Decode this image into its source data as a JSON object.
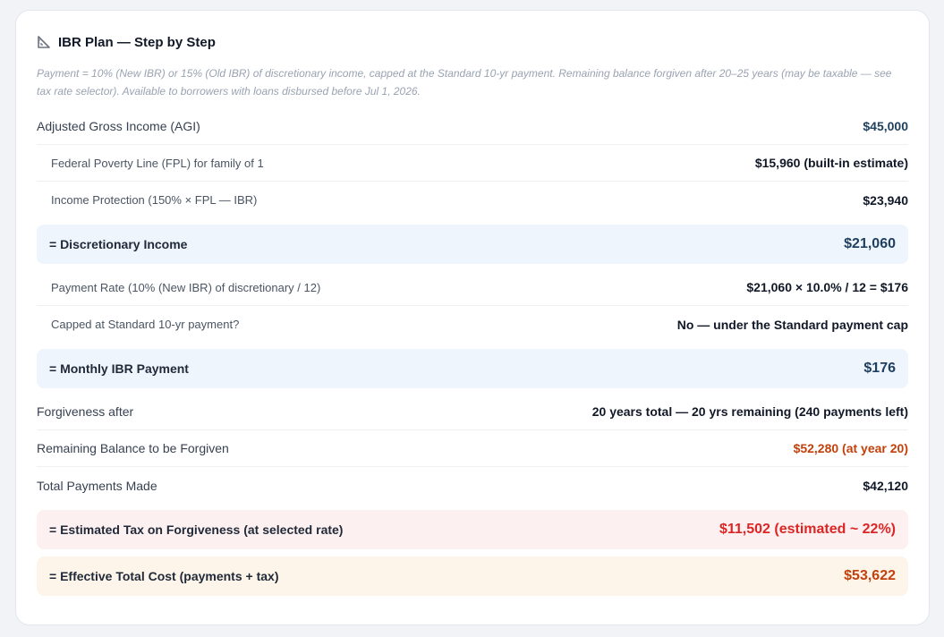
{
  "header": {
    "icon": "ruler-triangle-icon",
    "title": "IBR Plan — Step by Step"
  },
  "note": "Payment = 10% (New IBR) or 15% (Old IBR) of discretionary income, capped at the Standard 10-yr payment. Remaining balance forgiven after 20–25 years (may be taxable — see tax rate selector). Available to borrowers with loans disbursed before Jul 1, 2026.",
  "rows": {
    "agi": {
      "label": "Adjusted Gross Income (AGI)",
      "value": "$45,000"
    },
    "fpl": {
      "label": "Federal Poverty Line (FPL) for family of 1",
      "value": "$15,960 (built-in estimate)"
    },
    "protection": {
      "label": "Income Protection (150% × FPL — IBR)",
      "value": "$23,940"
    },
    "discretionary": {
      "label": "= Discretionary Income",
      "value": "$21,060"
    },
    "rate": {
      "label": "Payment Rate (10% (New IBR) of discretionary / 12)",
      "value": "$21,060 × 10.0% / 12 = $176"
    },
    "capped": {
      "label": "Capped at Standard 10-yr payment?",
      "value": "No — under the Standard payment cap"
    },
    "monthly": {
      "label": "= Monthly IBR Payment",
      "value": "$176"
    },
    "forgiveness": {
      "label": "Forgiveness after",
      "value": "20 years total — 20 yrs remaining (240 payments left)"
    },
    "remaining": {
      "label": "Remaining Balance to be Forgiven",
      "value": "$52,280 (at year 20)"
    },
    "total_payments": {
      "label": "Total Payments Made",
      "value": "$42,120"
    },
    "tax": {
      "label": "= Estimated Tax on Forgiveness (at selected rate)",
      "value": "$11,502 (estimated ~ 22%)"
    },
    "effective": {
      "label": "= Effective Total Cost (payments + tax)",
      "value": "$53,622"
    }
  },
  "colors": {
    "accent_blue_band": "#eef5fd",
    "tax_red": "#dc2626",
    "cost_orange": "#c2410c"
  }
}
